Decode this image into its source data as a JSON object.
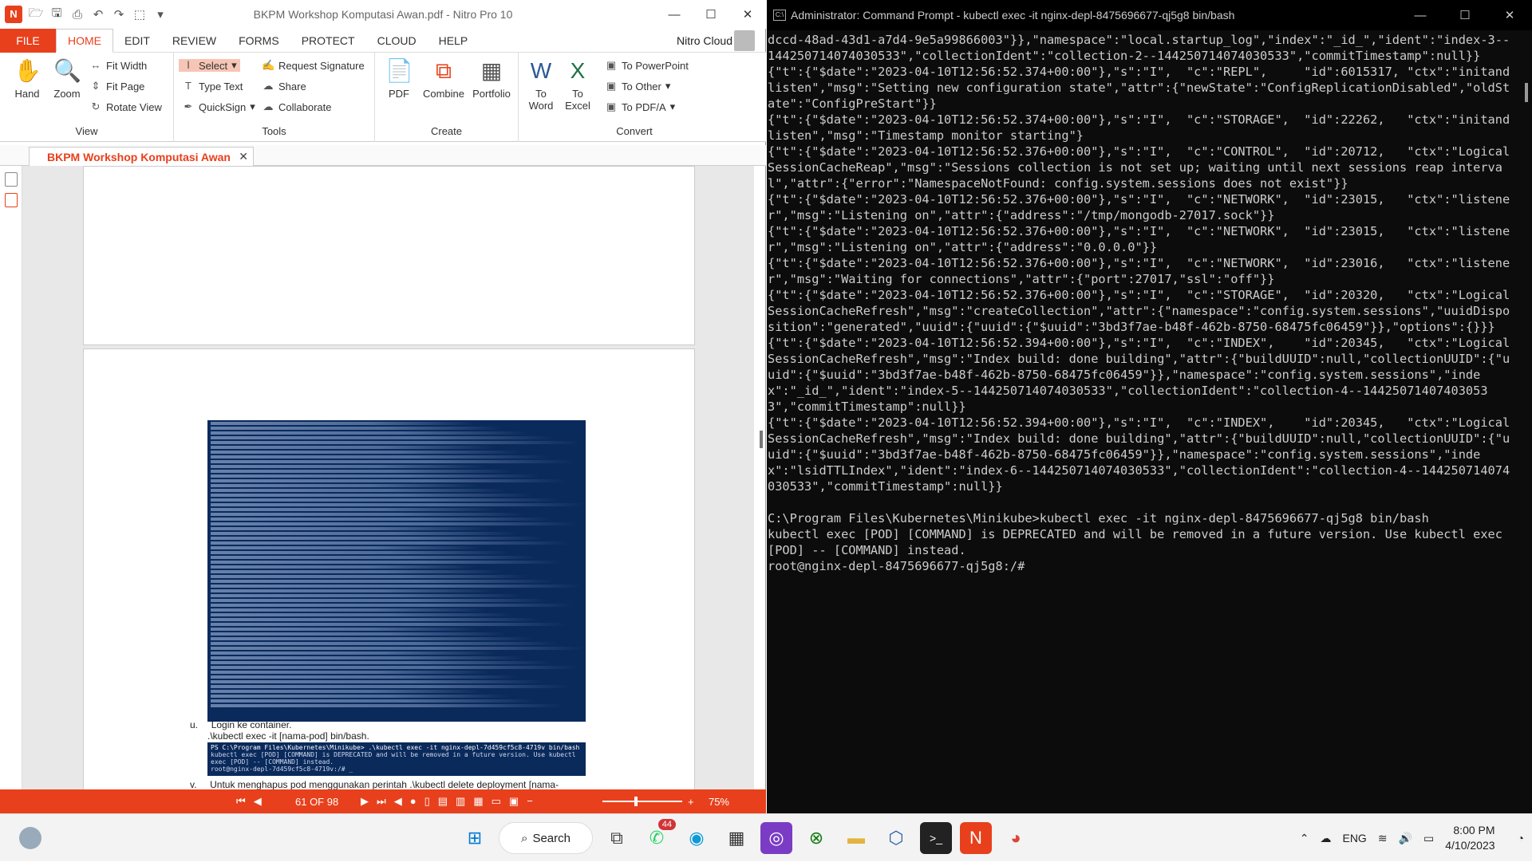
{
  "nitro": {
    "title": "BKPM Workshop Komputasi Awan.pdf - Nitro Pro 10",
    "tabs": [
      "FILE",
      "HOME",
      "EDIT",
      "REVIEW",
      "FORMS",
      "PROTECT",
      "CLOUD",
      "HELP"
    ],
    "nitro_cloud": "Nitro Cloud",
    "view": {
      "hand": "Hand",
      "zoom": "Zoom",
      "fit_width": "Fit Width",
      "fit_page": "Fit Page",
      "rotate_view": "Rotate View",
      "label": "View"
    },
    "tools": {
      "select": "Select",
      "type_text": "Type Text",
      "quicksign": "QuickSign",
      "request_signature": "Request Signature",
      "share": "Share",
      "collaborate": "Collaborate",
      "label": "Tools"
    },
    "create": {
      "pdf": "PDF",
      "combine": "Combine",
      "portfolio": "Portfolio",
      "label": "Create"
    },
    "convert": {
      "to_word": "To Word",
      "to_excel": "To Excel",
      "to_powerpoint": "To PowerPoint",
      "to_other": "To Other",
      "to_pdfa": "To PDF/A",
      "label": "Convert"
    },
    "doc_tab": "BKPM Workshop Komputasi Awan",
    "doc": {
      "u_label": "u.",
      "u_text": "Login ke container.",
      "u_cmd": ".\\kubectl exec -it [nama-pod] bin/bash.",
      "shot2_lines": [
        "PS C:\\Program Files\\Kubernetes\\Minikube> .\\kubectl exec -it nginx-depl-7d459cf5c8-4719v bin/bash",
        "kubectl exec [POD] [COMMAND] is DEPRECATED and will be removed in a future version. Use kubectl exec [POD] -- [COMMAND] instead.",
        "root@nginx-depl-7d459cf5c8-4719v:/# _"
      ],
      "v_label": "v.",
      "v_text": "Untuk menghapus pod menggunakan perintah .\\kubectl delete deployment [nama-"
    },
    "status": {
      "page": "61 OF 98",
      "zoom": "75%"
    }
  },
  "cmd": {
    "title": "Administrator: Command Prompt - kubectl  exec -it nginx-depl-8475696677-qj5g8 bin/bash",
    "output": "dccd-48ad-43d1-a7d4-9e5a99866003\"}},\"namespace\":\"local.startup_log\",\"index\":\"_id_\",\"ident\":\"index-3--144250714074030533\",\"collectionIdent\":\"collection-2--144250714074030533\",\"commitTimestamp\":null}}\n{\"t\":{\"$date\":\"2023-04-10T12:56:52.374+00:00\"},\"s\":\"I\",  \"c\":\"REPL\",     \"id\":6015317, \"ctx\":\"initandlisten\",\"msg\":\"Setting new configuration state\",\"attr\":{\"newState\":\"ConfigReplicationDisabled\",\"oldState\":\"ConfigPreStart\"}}\n{\"t\":{\"$date\":\"2023-04-10T12:56:52.374+00:00\"},\"s\":\"I\",  \"c\":\"STORAGE\",  \"id\":22262,   \"ctx\":\"initandlisten\",\"msg\":\"Timestamp monitor starting\"}\n{\"t\":{\"$date\":\"2023-04-10T12:56:52.376+00:00\"},\"s\":\"I\",  \"c\":\"CONTROL\",  \"id\":20712,   \"ctx\":\"LogicalSessionCacheReap\",\"msg\":\"Sessions collection is not set up; waiting until next sessions reap interval\",\"attr\":{\"error\":\"NamespaceNotFound: config.system.sessions does not exist\"}}\n{\"t\":{\"$date\":\"2023-04-10T12:56:52.376+00:00\"},\"s\":\"I\",  \"c\":\"NETWORK\",  \"id\":23015,   \"ctx\":\"listener\",\"msg\":\"Listening on\",\"attr\":{\"address\":\"/tmp/mongodb-27017.sock\"}}\n{\"t\":{\"$date\":\"2023-04-10T12:56:52.376+00:00\"},\"s\":\"I\",  \"c\":\"NETWORK\",  \"id\":23015,   \"ctx\":\"listener\",\"msg\":\"Listening on\",\"attr\":{\"address\":\"0.0.0.0\"}}\n{\"t\":{\"$date\":\"2023-04-10T12:56:52.376+00:00\"},\"s\":\"I\",  \"c\":\"NETWORK\",  \"id\":23016,   \"ctx\":\"listener\",\"msg\":\"Waiting for connections\",\"attr\":{\"port\":27017,\"ssl\":\"off\"}}\n{\"t\":{\"$date\":\"2023-04-10T12:56:52.376+00:00\"},\"s\":\"I\",  \"c\":\"STORAGE\",  \"id\":20320,   \"ctx\":\"LogicalSessionCacheRefresh\",\"msg\":\"createCollection\",\"attr\":{\"namespace\":\"config.system.sessions\",\"uuidDisposition\":\"generated\",\"uuid\":{\"uuid\":{\"$uuid\":\"3bd3f7ae-b48f-462b-8750-68475fc06459\"}},\"options\":{}}}\n{\"t\":{\"$date\":\"2023-04-10T12:56:52.394+00:00\"},\"s\":\"I\",  \"c\":\"INDEX\",    \"id\":20345,   \"ctx\":\"LogicalSessionCacheRefresh\",\"msg\":\"Index build: done building\",\"attr\":{\"buildUUID\":null,\"collectionUUID\":{\"uuid\":{\"$uuid\":\"3bd3f7ae-b48f-462b-8750-68475fc06459\"}},\"namespace\":\"config.system.sessions\",\"index\":\"_id_\",\"ident\":\"index-5--144250714074030533\",\"collectionIdent\":\"collection-4--144250714074030533\",\"commitTimestamp\":null}}\n{\"t\":{\"$date\":\"2023-04-10T12:56:52.394+00:00\"},\"s\":\"I\",  \"c\":\"INDEX\",    \"id\":20345,   \"ctx\":\"LogicalSessionCacheRefresh\",\"msg\":\"Index build: done building\",\"attr\":{\"buildUUID\":null,\"collectionUUID\":{\"uuid\":{\"$uuid\":\"3bd3f7ae-b48f-462b-8750-68475fc06459\"}},\"namespace\":\"config.system.sessions\",\"index\":\"lsidTTLIndex\",\"ident\":\"index-6--144250714074030533\",\"collectionIdent\":\"collection-4--144250714074030533\",\"commitTimestamp\":null}}\n\nC:\\Program Files\\Kubernetes\\Minikube>kubectl exec -it nginx-depl-8475696677-qj5g8 bin/bash\nkubectl exec [POD] [COMMAND] is DEPRECATED and will be removed in a future version. Use kubectl exec [POD] -- [COMMAND] instead.\nroot@nginx-depl-8475696677-qj5g8:/#"
  },
  "taskbar": {
    "search": "Search",
    "whatsapp_badge": "44",
    "lang": "ENG",
    "time": "8:00 PM",
    "date": "4/10/2023"
  },
  "colors": {
    "nitro_accent": "#e8401c",
    "terminal_bg": "#0c0c0c"
  }
}
